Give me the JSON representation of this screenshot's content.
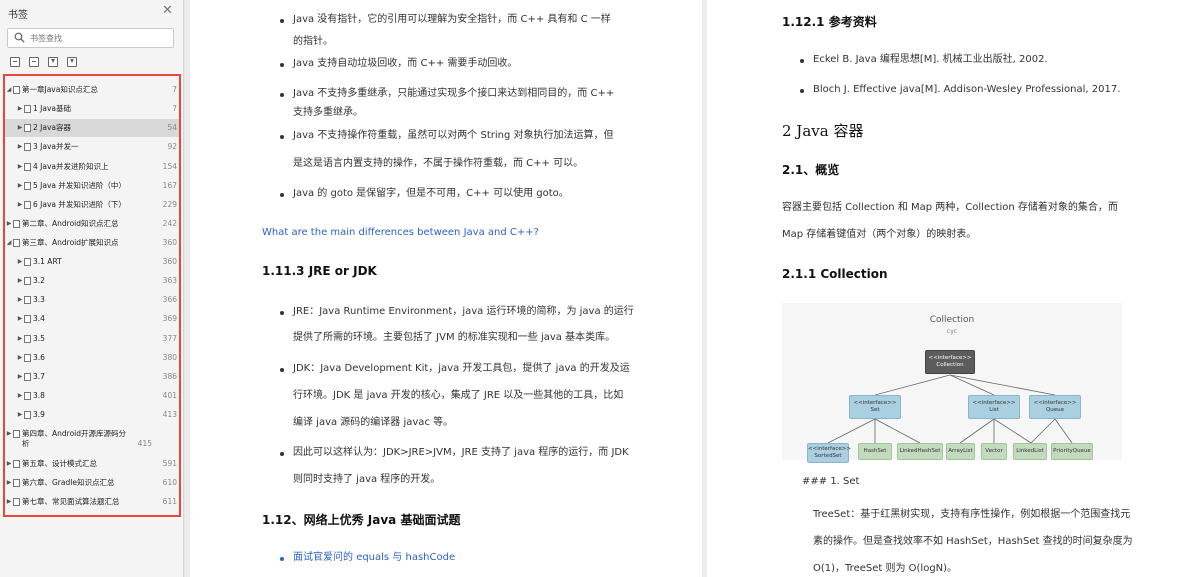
{
  "sidebar": {
    "title": "书签",
    "search_placeholder": "书签查找",
    "items": [
      {
        "label": "第一章Java知识点汇总",
        "page": "7",
        "level": 0,
        "expanded": true
      },
      {
        "label": "1 Java基础",
        "page": "7",
        "level": 1
      },
      {
        "label": "2 Java容器",
        "page": "54",
        "level": 1,
        "selected": true
      },
      {
        "label": "3 Java并发一",
        "page": "92",
        "level": 1
      },
      {
        "label": "4 Java并发进阶知识上",
        "page": "154",
        "level": 1
      },
      {
        "label": "5 Java 并发知识进阶（中）",
        "page": "167",
        "level": 1
      },
      {
        "label": "6 Java 并发知识进阶（下）",
        "page": "229",
        "level": 1
      },
      {
        "label": "第二章、Android知识点汇总",
        "page": "242",
        "level": 0
      },
      {
        "label": "第三章、Android扩展知识点",
        "page": "360",
        "level": 0,
        "expanded": true
      },
      {
        "label": "3.1 ART",
        "page": "360",
        "level": 1
      },
      {
        "label": "3.2",
        "page": "363",
        "level": 1
      },
      {
        "label": "3.3",
        "page": "366",
        "level": 1
      },
      {
        "label": "3.4",
        "page": "369",
        "level": 1
      },
      {
        "label": "3.5",
        "page": "377",
        "level": 1
      },
      {
        "label": "3.6",
        "page": "380",
        "level": 1
      },
      {
        "label": "3.7",
        "page": "386",
        "level": 1
      },
      {
        "label": "3.8",
        "page": "401",
        "level": 1
      },
      {
        "label": "3.9",
        "page": "413",
        "level": 1
      },
      {
        "label": "第四章、Android开源库源码分析",
        "page": "415",
        "level": 0
      },
      {
        "label": "第五章、设计模式汇总",
        "page": "591",
        "level": 0
      },
      {
        "label": "第六章、Gradle知识点汇总",
        "page": "610",
        "level": 0
      },
      {
        "label": "第七章、常见面试算法题汇总",
        "page": "611",
        "level": 0
      }
    ]
  },
  "left_page": {
    "bullets_top": [
      "Java 没有指针，它的引用可以理解为安全指针，而 C++ 具有和 C 一样",
      "的指针。",
      "Java 支持自动垃圾回收，而 C++ 需要手动回收。",
      "Java 不支持多重继承，只能通过实现多个接口来达到相同目的，而 C++",
      "支持多重继承。",
      "Java 不支持操作符重载，虽然可以对两个 String 对象执行加法运算，但",
      "是这是语言内置支持的操作，不属于操作符重载，而 C++ 可以。",
      "Java 的 goto 是保留字，但是不可用，C++ 可以使用 goto。"
    ],
    "link_diff": "What are the main differences between Java and C++?",
    "heading_jre": "1.11.3 JRE or JDK",
    "jre_lines": [
      "JRE：Java Runtime Environment，java 运行环境的简称，为 java 的运行",
      "提供了所需的环境。主要包括了 JVM 的标准实现和一些 java 基本类库。",
      "JDK：Java Development Kit，java 开发工具包，提供了 java 的开发及运",
      "行环境。JDK 是 java 开发的核心，集成了 JRE 以及一些其他的工具，比如",
      "编译 java 源码的编译器 javac 等。",
      "因此可以这样认为：JDK>JRE>JVM，JRE 支持了 java 程序的运行，而 JDK",
      "则同时支持了 java 程序的开发。"
    ],
    "heading_112": "1.12、网络上优秀 Java 基础面试题",
    "link_hash": "面试官爱问的 equals 与 hashCode"
  },
  "right_page": {
    "heading_ref": "1.12.1  参考资料",
    "refs": [
      "Eckel B. Java  编程思想[M]. 机械工业出版社, 2002.",
      "Bloch J. Effective java[M]. Addison-Wesley Professional, 2017."
    ],
    "heading_ch2": "2  Java 容器",
    "heading_21": "2.1、概览",
    "overview": [
      "容器主要包括 Collection 和 Map 两种，Collection 存储着对象的集合，而",
      "Map 存储着键值对（两个对象）的映射表。"
    ],
    "heading_211": "2.1.1 Collection",
    "diagram": {
      "title": "Collection",
      "subtitle": "cyc",
      "root": "<<interface>>\nCollection",
      "set": "<<interface>>\nSet",
      "list": "<<interface>>\nList",
      "queue": "<<interface>>\nQueue",
      "impls": [
        "SortedSet",
        "HashSet",
        "LinkedHashSet",
        "ArrayList",
        "Vector",
        "LinkedList",
        "PriorityQueue"
      ]
    },
    "heading_set": "### 1. Set",
    "treeset": [
      "TreeSet：基于红黑树实现，支持有序性操作，例如根据一个范围查找元",
      "素的操作。但是查找效率不如 HashSet，HashSet 查找的时间复杂度为",
      "O(1)，TreeSet 则为 O(logN)。"
    ]
  }
}
